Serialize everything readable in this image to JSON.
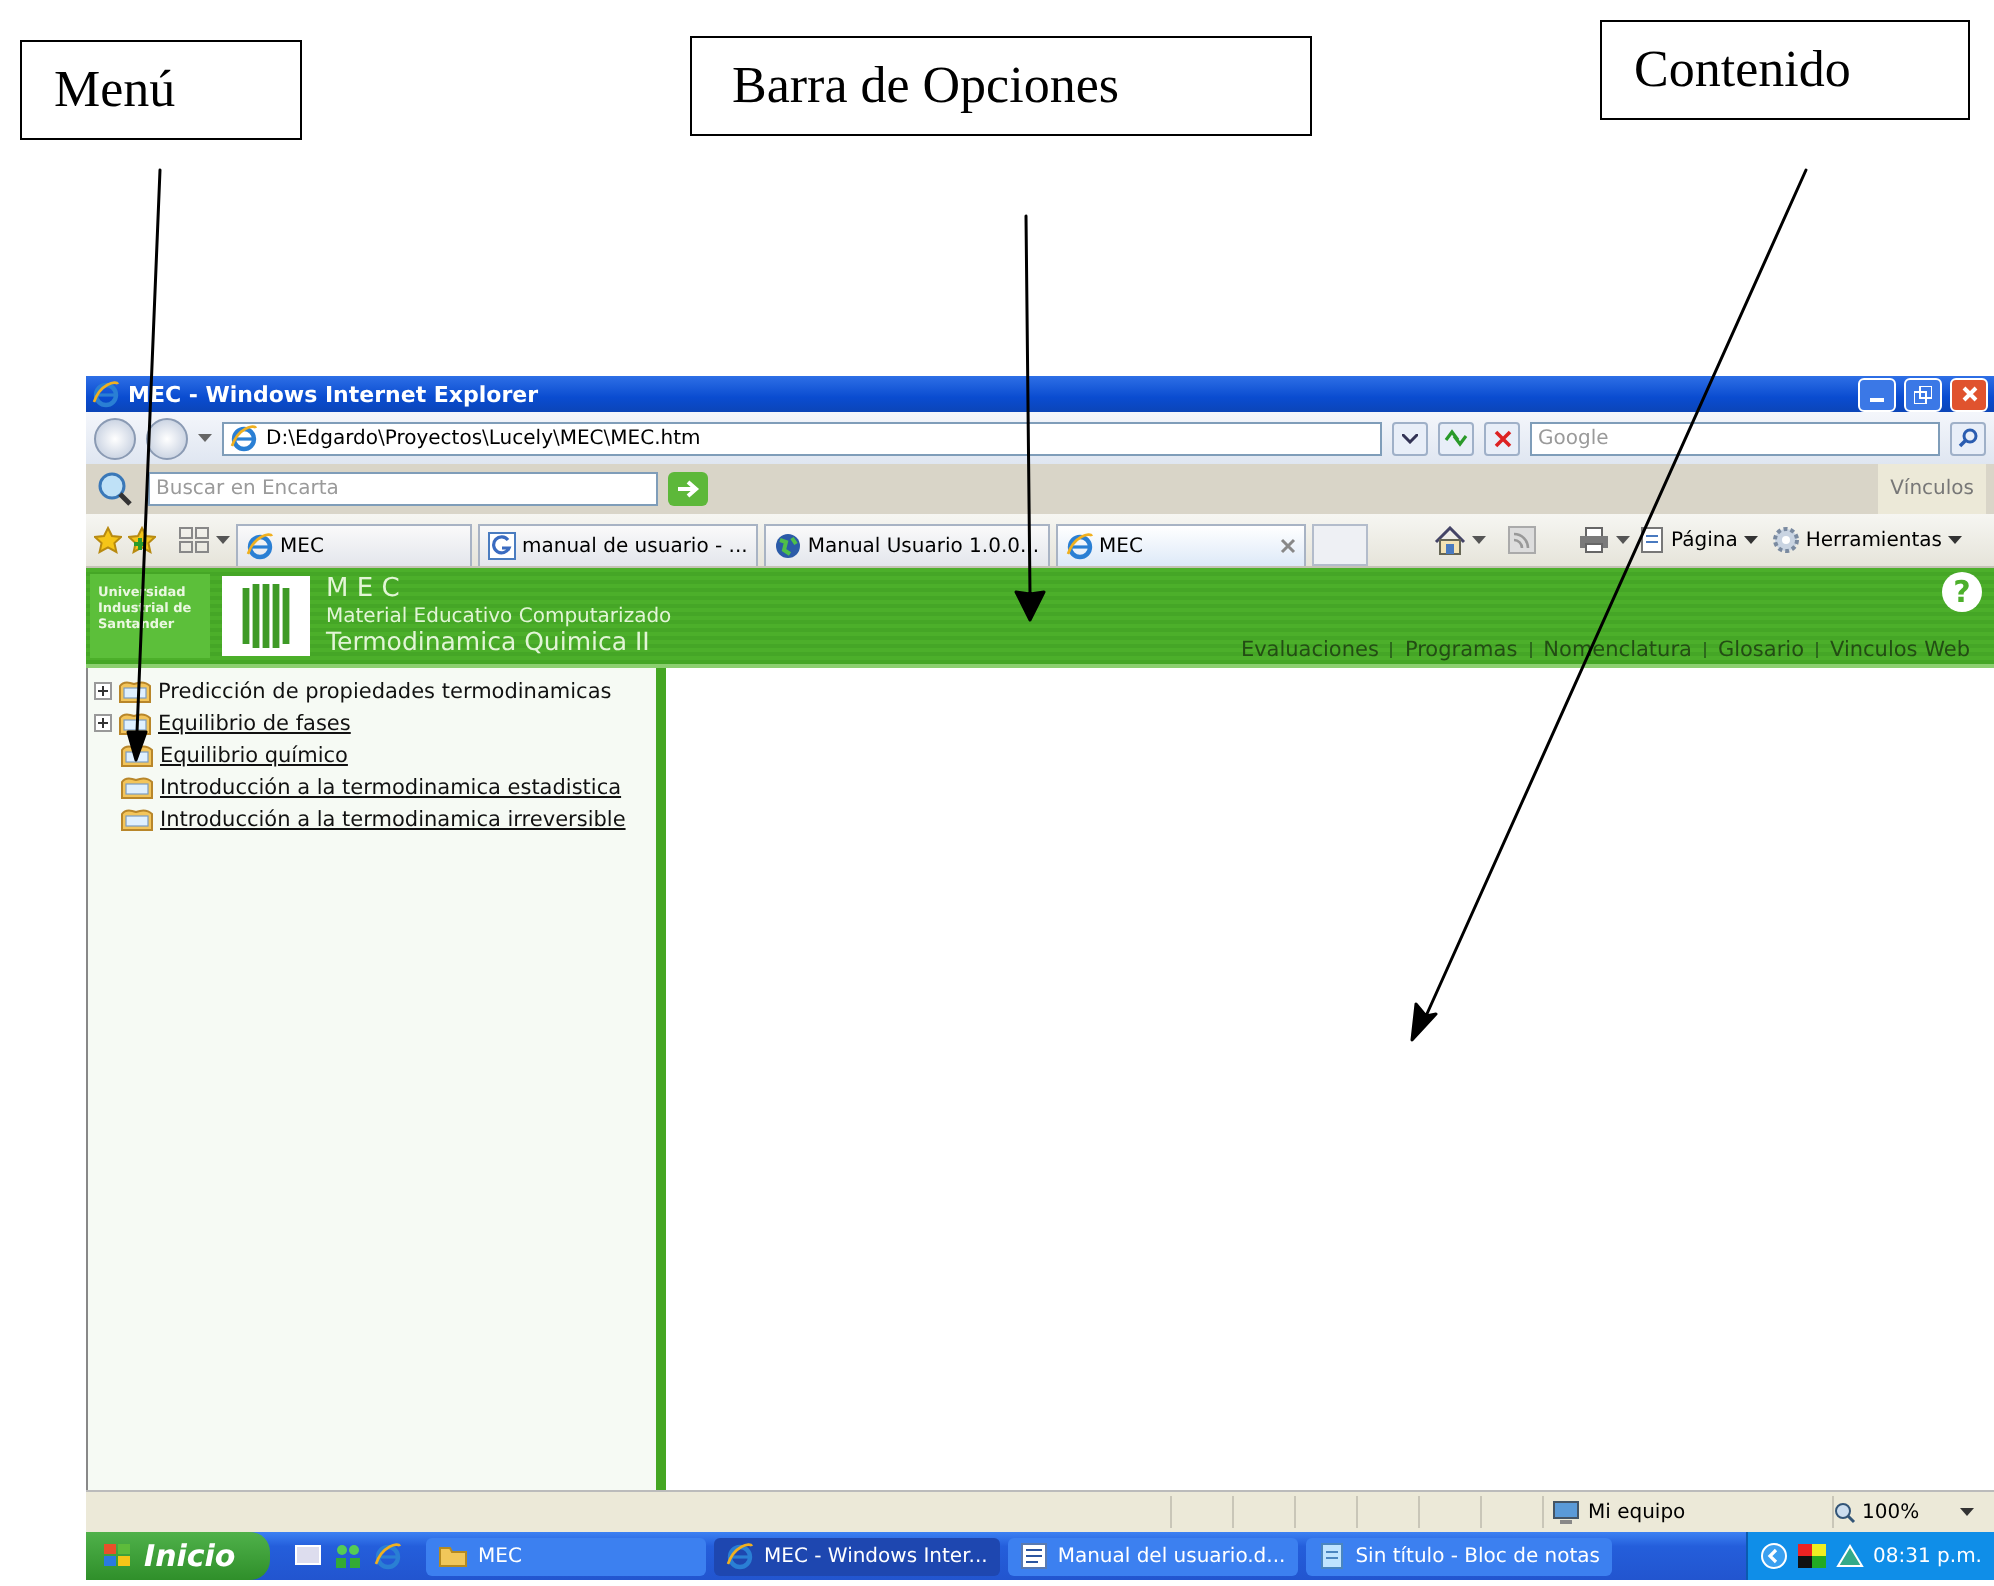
{
  "callouts": [
    {
      "label": "Menú"
    },
    {
      "label": "Barra de Opciones"
    },
    {
      "label": "Contenido"
    }
  ],
  "window": {
    "title": "MEC - Windows Internet Explorer",
    "address": "D:\\Edgardo\\Proyectos\\Lucely\\MEC\\MEC.htm",
    "search_placeholder": "Google",
    "encarta_placeholder": "Buscar en Encarta",
    "links_label": "Vínculos",
    "tabs": [
      {
        "label": "MEC",
        "kind": "ie",
        "selected": false
      },
      {
        "label": "manual de usuario - ...",
        "kind": "google",
        "selected": false
      },
      {
        "label": "Manual Usuario 1.0.0...",
        "kind": "globe",
        "selected": false
      },
      {
        "label": "MEC",
        "kind": "ie",
        "selected": true
      }
    ],
    "commands": [
      "Página",
      "Herramientas"
    ]
  },
  "page": {
    "brand": "Universidad Industrial de Santander",
    "title": "M E C",
    "subtitle": "Material Educativo Computarizado",
    "course": "Termodinamica Quimica II",
    "help_symbol": "?",
    "nav": [
      "Evaluaciones",
      "Programas",
      "Nomenclatura",
      "Glosario",
      "Vinculos Web"
    ],
    "menu": [
      {
        "label": "Predicción de propiedades termodinamicas",
        "kind": "group",
        "expanded": false,
        "underlined": false
      },
      {
        "label": "Equilibrio de fases",
        "kind": "group",
        "expanded": false,
        "underlined": true
      },
      {
        "label": "Equilibrio químico",
        "kind": "page",
        "underlined": true
      },
      {
        "label": "Introducción a la termodinamica estadistica",
        "kind": "page",
        "underlined": true
      },
      {
        "label": "Introducción a la termodinamica irreversible",
        "kind": "page",
        "underlined": true
      }
    ]
  },
  "status_bar": {
    "zone": "Mi equipo",
    "zoom": "100%"
  },
  "taskbar": {
    "start": "Inicio",
    "tasks": [
      {
        "label": "MEC",
        "kind": "folder",
        "selected": false
      },
      {
        "label": "MEC - Windows Inter...",
        "kind": "ie",
        "selected": true
      },
      {
        "label": "Manual del usuario.d...",
        "kind": "doc",
        "selected": false
      },
      {
        "label": "Sin título - Bloc de notas",
        "kind": "notepad",
        "selected": false
      }
    ],
    "clock": "08:31 p.m."
  }
}
